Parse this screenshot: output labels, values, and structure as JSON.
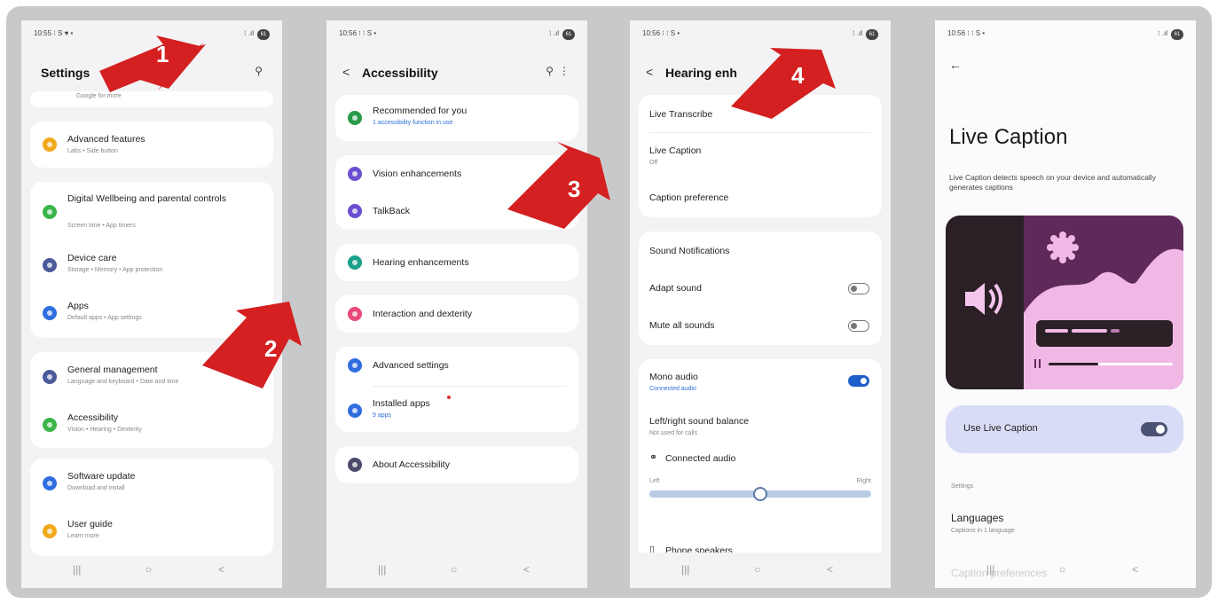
{
  "status": {
    "p1_time": "10:55 ⁝ S ♥ •",
    "p2_time": "10:56 ⁝ ⁝ S •",
    "p3_time": "10:56 ⁝ ⁝ S •",
    "p4_time": "10:56 ⁝ ⁝ S •",
    "signal": "⁝ .ıl",
    "battery": "61"
  },
  "steps": [
    "1",
    "2",
    "3",
    "4"
  ],
  "settings": {
    "title": "Settings",
    "search_icon": "search-icon",
    "top_partial_sub": "Google for more",
    "items": [
      {
        "label": "Advanced features",
        "sub": "Labs • Side button",
        "color": "#f0a81c"
      },
      {
        "label": "Digital Wellbeing and parental controls",
        "sub": "Screen time • App timers",
        "color": "#3ab54a"
      },
      {
        "label": "Device care",
        "sub": "Storage • Memory • App protection",
        "color": "#4a5a9a"
      },
      {
        "label": "Apps",
        "sub": "Default apps • App settings",
        "color": "#2f6ee0"
      },
      {
        "label": "General management",
        "sub": "Language and keyboard • Date and time",
        "color": "#4a5a9a"
      },
      {
        "label": "Accessibility",
        "sub": "Vision • Hearing • Dexterity",
        "color": "#3ab54a"
      },
      {
        "label": "Software update",
        "sub": "Download and install",
        "color": "#2f6ee0"
      },
      {
        "label": "User guide",
        "sub": "Learn more",
        "color": "#f0a81c"
      }
    ]
  },
  "accessibility": {
    "title": "Accessibility",
    "items": [
      {
        "label": "Recommended for you",
        "sub": "1 accessibility function in use",
        "color": "#2a9a4a"
      },
      {
        "label": "Vision enhancements",
        "sub": "",
        "color": "#6a4fd0"
      },
      {
        "label": "TalkBack",
        "sub": "",
        "color": "#6a4fd0"
      },
      {
        "label": "Hearing enhancements",
        "sub": "",
        "color": "#1aa08a"
      },
      {
        "label": "Interaction and dexterity",
        "sub": "",
        "color": "#e84a7a"
      },
      {
        "label": "Advanced settings",
        "sub": "",
        "color": "#2f6ee0"
      },
      {
        "label": "Installed apps",
        "sub": "9 apps",
        "color": "#2f6ee0"
      },
      {
        "label": "About Accessibility",
        "sub": "",
        "color": "#4a4a6a"
      }
    ]
  },
  "hearing": {
    "title": "Hearing enh",
    "live_transcribe": "Live Transcribe",
    "live_caption": "Live Caption",
    "live_caption_sub": "Off",
    "caption_pref": "Caption preference",
    "sound_notifications": "Sound Notifications",
    "adapt_sound": "Adapt sound",
    "adapt_sound_on": false,
    "mute_all": "Mute all sounds",
    "mute_all_on": false,
    "mono_audio": "Mono audio",
    "mono_audio_sub": "Connected audio",
    "mono_audio_on": true,
    "balance": "Left/right sound balance",
    "balance_sub": "Not used for calls",
    "connected_audio": "Connected audio",
    "left": "Left",
    "right": "Right",
    "balance_value": 0.5,
    "phone_speakers": "Phone speakers"
  },
  "live_caption": {
    "title": "Live Caption",
    "description": "Live Caption detects speech on your device and automatically generates captions",
    "use_label": "Use Live Caption",
    "use_on": true,
    "settings_header": "Settings",
    "languages": "Languages",
    "languages_sub": "Captions in 1 language",
    "partial_next": "Caption preferences"
  },
  "colors": {
    "arrow": "#d42020",
    "accent": "#1f5fc8"
  }
}
